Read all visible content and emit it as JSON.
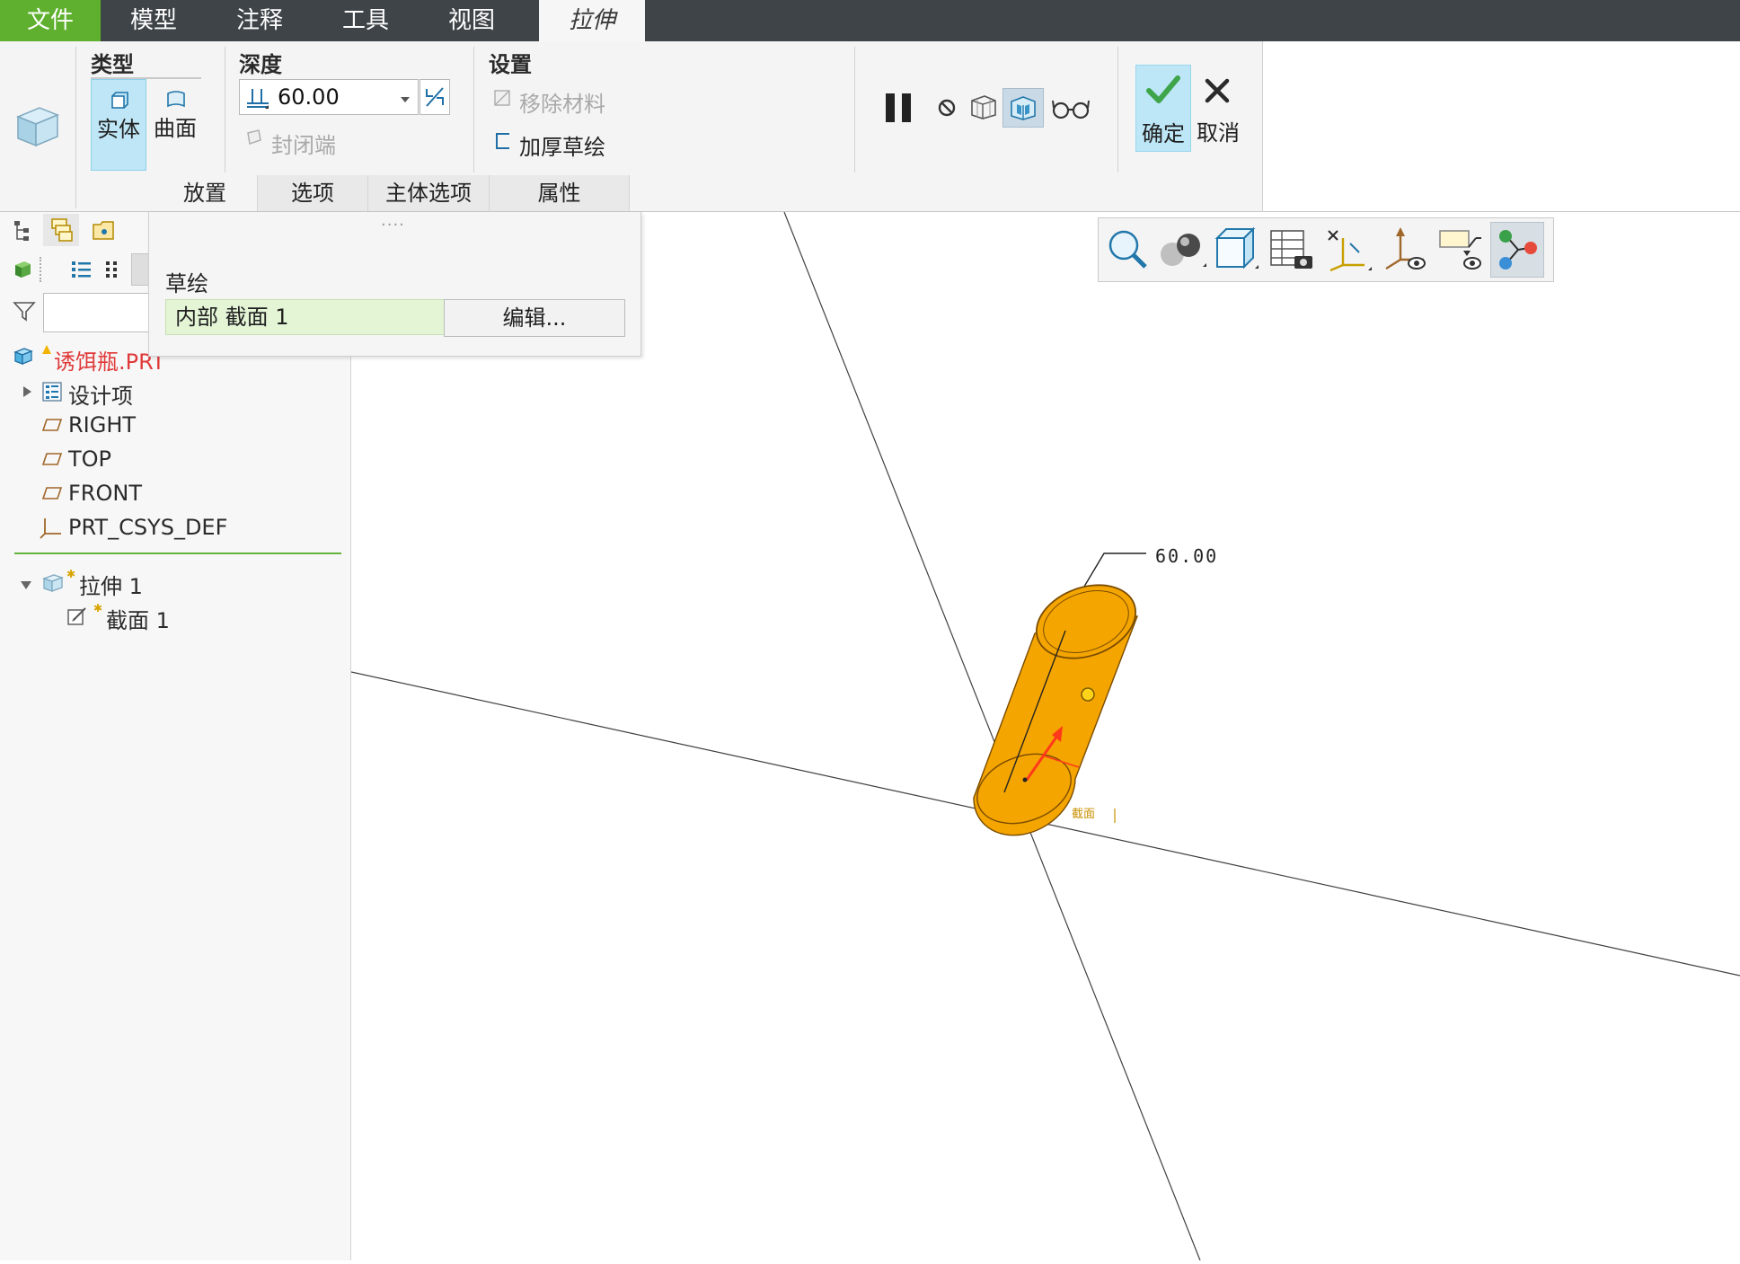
{
  "menubar": {
    "items": [
      {
        "label": "文件"
      },
      {
        "label": "模型"
      },
      {
        "label": "注释"
      },
      {
        "label": "工具"
      },
      {
        "label": "视图"
      },
      {
        "label": "拉伸"
      }
    ]
  },
  "ribbon": {
    "type_group": {
      "title": "类型",
      "solid": "实体",
      "surface": "曲面"
    },
    "depth_group": {
      "title": "深度",
      "value": "60.00",
      "capped_ends": "封闭端"
    },
    "settings_group": {
      "title": "设置",
      "remove_material": "移除材料",
      "thicken_sketch": "加厚草绘"
    },
    "actions": {
      "confirm": "确定",
      "cancel": "取消"
    },
    "tabs": [
      {
        "label": "放置"
      },
      {
        "label": "选项"
      },
      {
        "label": "主体选项"
      },
      {
        "label": "属性"
      }
    ]
  },
  "placement_panel": {
    "sketch_label": "草绘",
    "sketch_value": "内部 截面 1",
    "edit_button": "编辑..."
  },
  "model_tree": {
    "root": "诱饵瓶.PRT",
    "items": [
      {
        "label": "设计项"
      },
      {
        "label": "RIGHT"
      },
      {
        "label": "TOP"
      },
      {
        "label": "FRONT"
      },
      {
        "label": "PRT_CSYS_DEF"
      }
    ],
    "feature": {
      "label": "拉伸 1",
      "child": "截面 1"
    }
  },
  "viewport": {
    "dimension_label": "60.00",
    "section_tag": "截面",
    "colors": {
      "part": "#f5a500",
      "part_edge": "#7a4c00",
      "datum_line": "#404040",
      "arrow": "#ff3a1a"
    }
  }
}
